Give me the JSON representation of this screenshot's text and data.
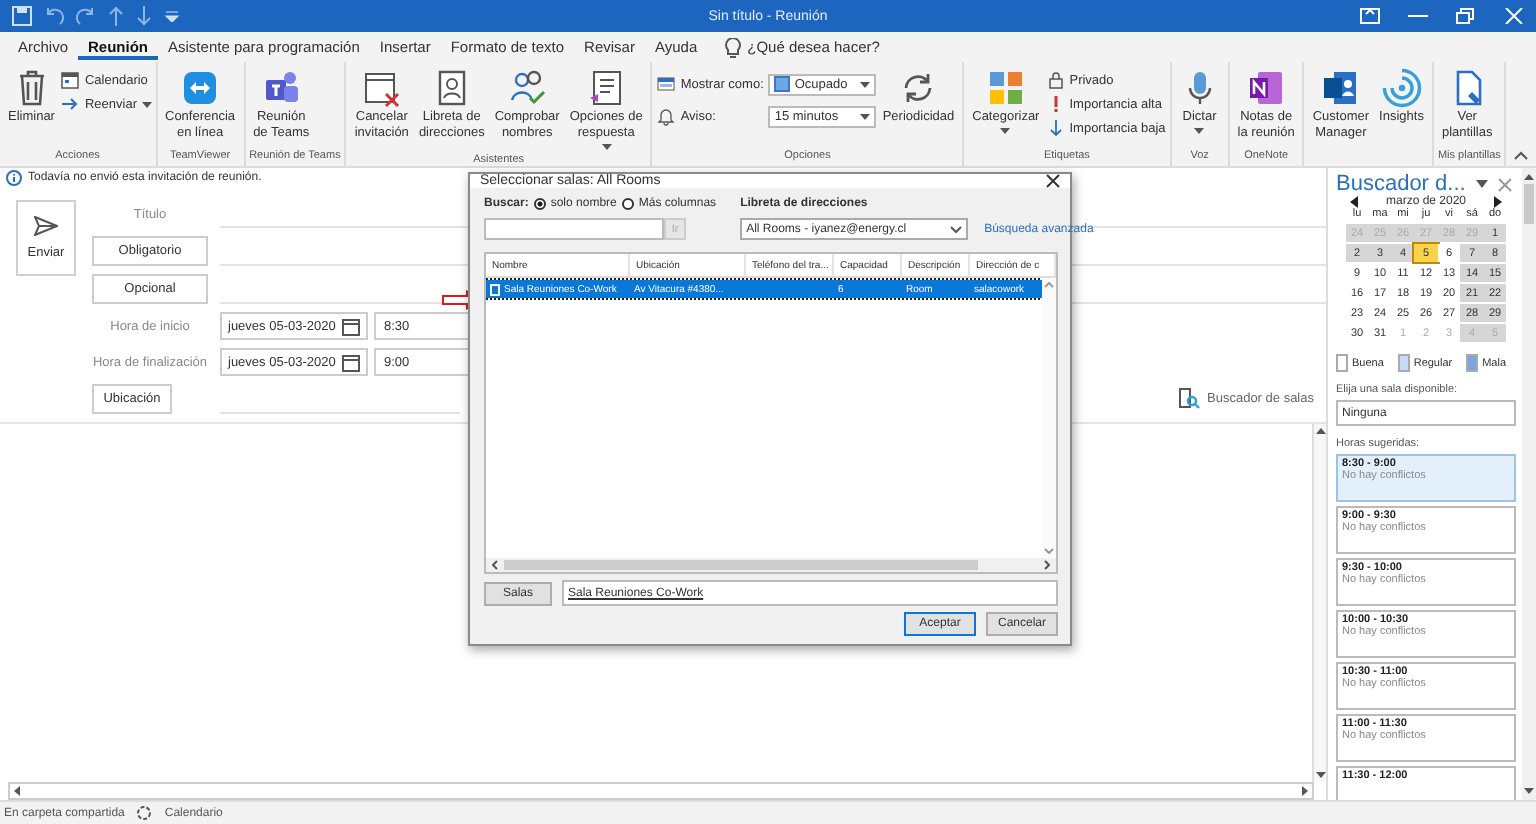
{
  "window": {
    "title": "Sin título  -  Reunión"
  },
  "menu_tabs": [
    {
      "label": "Archivo",
      "selected": false
    },
    {
      "label": "Reunión",
      "selected": true
    },
    {
      "label": "Asistente para programación",
      "selected": false
    },
    {
      "label": "Insertar",
      "selected": false
    },
    {
      "label": "Formato de texto",
      "selected": false
    },
    {
      "label": "Revisar",
      "selected": false
    },
    {
      "label": "Ayuda",
      "selected": false
    }
  ],
  "tell_me": {
    "placeholder": "¿Qué desea hacer?"
  },
  "ribbon": [
    {
      "label": "Acciones",
      "items": [
        {
          "kind": "large",
          "label": "Eliminar"
        },
        {
          "kind": "small",
          "label": "Calendario"
        },
        {
          "kind": "small",
          "label": "Reenviar",
          "menu": true
        }
      ]
    },
    {
      "label": "TeamViewer",
      "items": [
        {
          "kind": "large",
          "label": "Conferencia\nen línea"
        }
      ]
    },
    {
      "label": "Reunión de Teams",
      "items": [
        {
          "kind": "large",
          "label": "Reunión\nde Teams"
        }
      ]
    },
    {
      "label": "Asistentes",
      "items": [
        {
          "kind": "large",
          "label": "Cancelar\ninvitación"
        },
        {
          "kind": "large",
          "label": "Libreta de\ndirecciones"
        },
        {
          "kind": "large",
          "label": "Comprobar\nnombres"
        },
        {
          "kind": "large",
          "label": "Opciones de\nrespuesta",
          "menu": true
        }
      ]
    },
    {
      "label": "Opciones",
      "items": [
        {
          "kind": "field",
          "label": "Mostrar como:",
          "value": "Ocupado"
        },
        {
          "kind": "field",
          "label": "Aviso:",
          "value": "15 minutos"
        },
        {
          "kind": "large",
          "label": "Periodicidad"
        }
      ]
    },
    {
      "label": "Etiquetas",
      "items": [
        {
          "kind": "large",
          "label": "Categorizar",
          "menu": true
        },
        {
          "kind": "small",
          "label": "Privado"
        },
        {
          "kind": "small",
          "label": "Importancia alta"
        },
        {
          "kind": "small",
          "label": "Importancia baja"
        }
      ]
    },
    {
      "label": "Voz",
      "items": [
        {
          "kind": "large",
          "label": "Dictar",
          "menu": true
        }
      ]
    },
    {
      "label": "OneNote",
      "items": [
        {
          "kind": "large",
          "label": "Notas de\nla reunión"
        }
      ]
    },
    {
      "items": [
        {
          "kind": "large",
          "label": "Customer\nManager"
        },
        {
          "kind": "large",
          "label": "Insights"
        }
      ]
    },
    {
      "label": "Mis plantillas",
      "items": [
        {
          "kind": "large",
          "label": "Ver\nplantillas"
        }
      ]
    }
  ],
  "info_bar": "Todavía no envió esta invitación de reunión.",
  "form": {
    "send": "Enviar",
    "title_label": "Título",
    "required": "Obligatorio",
    "optional": "Opcional",
    "start_label": "Hora de inicio",
    "start_date": "jueves 05-03-2020",
    "start_time": "8:30",
    "end_label": "Hora de finalización",
    "end_date": "jueves 05-03-2020",
    "end_time": "9:00",
    "location": "Ubicación",
    "room_finder": "Buscador de salas"
  },
  "status_bar": {
    "folder": "En carpeta compartida",
    "calendar": "Calendario"
  },
  "dialog": {
    "title": "Seleccionar salas: All Rooms",
    "search_label": "Buscar:",
    "search_modes": [
      {
        "label": "solo nombre",
        "selected": true
      },
      {
        "label": "Más columnas",
        "selected": false
      }
    ],
    "address_book_label": "Libreta de direcciones",
    "go_button": {
      "label": "Ir",
      "disabled": true
    },
    "address_book": "All Rooms - iyanez@energy.cl",
    "advanced_link": "Búsqueda avanzada",
    "columns": [
      "Nombre",
      "Ubicación",
      "Teléfono del tra...",
      "Capacidad",
      "Descripción",
      "Dirección de c"
    ],
    "rows": [
      {
        "selected": true,
        "cells": [
          "Sala Reuniones Co-Work",
          "Av Vitacura #4380...",
          "",
          "6",
          "Room",
          "salacowork"
        ]
      }
    ],
    "rooms_button": "Salas",
    "rooms_value": "Sala Reuniones Co-Work",
    "ok": "Aceptar",
    "cancel": "Cancelar"
  },
  "room_finder": {
    "title": "Buscador d...",
    "month": "marzo de 2020",
    "weekdays": [
      "lu",
      "ma",
      "mi",
      "ju",
      "vi",
      "sá",
      "do"
    ],
    "weeks": [
      [
        {
          "day": "24",
          "muted": true,
          "shaded": true,
          "selected": false
        },
        {
          "day": "25",
          "muted": true,
          "shaded": true,
          "selected": false
        },
        {
          "day": "26",
          "muted": true,
          "shaded": true,
          "selected": false
        },
        {
          "day": "27",
          "muted": true,
          "shaded": true,
          "selected": false
        },
        {
          "day": "28",
          "muted": true,
          "shaded": true,
          "selected": false
        },
        {
          "day": "29",
          "muted": true,
          "shaded": true,
          "selected": false
        },
        {
          "day": "1",
          "muted": false,
          "shaded": true,
          "selected": false
        }
      ],
      [
        {
          "day": "2",
          "muted": false,
          "shaded": true,
          "selected": false
        },
        {
          "day": "3",
          "muted": false,
          "shaded": true,
          "selected": false
        },
        {
          "day": "4",
          "muted": false,
          "shaded": true,
          "selected": false
        },
        {
          "day": "5",
          "muted": false,
          "shaded": false,
          "selected": true
        },
        {
          "day": "6",
          "muted": false,
          "shaded": false,
          "selected": false
        },
        {
          "day": "7",
          "muted": false,
          "shaded": true,
          "selected": false
        },
        {
          "day": "8",
          "muted": false,
          "shaded": true,
          "selected": false
        }
      ],
      [
        {
          "day": "9",
          "muted": false,
          "shaded": false,
          "selected": false
        },
        {
          "day": "10",
          "muted": false,
          "shaded": false,
          "selected": false
        },
        {
          "day": "11",
          "muted": false,
          "shaded": false,
          "selected": false
        },
        {
          "day": "12",
          "muted": false,
          "shaded": false,
          "selected": false
        },
        {
          "day": "13",
          "muted": false,
          "shaded": false,
          "selected": false
        },
        {
          "day": "14",
          "muted": false,
          "shaded": true,
          "selected": false
        },
        {
          "day": "15",
          "muted": false,
          "shaded": true,
          "selected": false
        }
      ],
      [
        {
          "day": "16",
          "muted": false,
          "shaded": false,
          "selected": false
        },
        {
          "day": "17",
          "muted": false,
          "shaded": false,
          "selected": false
        },
        {
          "day": "18",
          "muted": false,
          "shaded": false,
          "selected": false
        },
        {
          "day": "19",
          "muted": false,
          "shaded": false,
          "selected": false
        },
        {
          "day": "20",
          "muted": false,
          "shaded": false,
          "selected": false
        },
        {
          "day": "21",
          "muted": false,
          "shaded": true,
          "selected": false
        },
        {
          "day": "22",
          "muted": false,
          "shaded": true,
          "selected": false
        }
      ],
      [
        {
          "day": "23",
          "muted": false,
          "shaded": false,
          "selected": false
        },
        {
          "day": "24",
          "muted": false,
          "shaded": false,
          "selected": false
        },
        {
          "day": "25",
          "muted": false,
          "shaded": false,
          "selected": false
        },
        {
          "day": "26",
          "muted": false,
          "shaded": false,
          "selected": false
        },
        {
          "day": "27",
          "muted": false,
          "shaded": false,
          "selected": false
        },
        {
          "day": "28",
          "muted": false,
          "shaded": true,
          "selected": false
        },
        {
          "day": "29",
          "muted": false,
          "shaded": true,
          "selected": false
        }
      ],
      [
        {
          "day": "30",
          "muted": false,
          "shaded": false,
          "selected": false
        },
        {
          "day": "31",
          "muted": false,
          "shaded": false,
          "selected": false
        },
        {
          "day": "1",
          "muted": true,
          "shaded": false,
          "selected": false
        },
        {
          "day": "2",
          "muted": true,
          "shaded": false,
          "selected": false
        },
        {
          "day": "3",
          "muted": true,
          "shaded": false,
          "selected": false
        },
        {
          "day": "4",
          "muted": true,
          "shaded": true,
          "selected": false
        },
        {
          "day": "5",
          "muted": true,
          "shaded": true,
          "selected": false
        }
      ]
    ],
    "legend": [
      {
        "label": "Buena",
        "color": "#ffffff"
      },
      {
        "label": "Regular",
        "color": "#c7dcf7"
      },
      {
        "label": "Mala",
        "color": "#7ba7e1"
      }
    ],
    "rooms_label": "Elija una sala disponible:",
    "rooms": [
      "Ninguna"
    ],
    "suggested_label": "Horas sugeridas:",
    "slots": [
      {
        "time": "8:30 - 9:00",
        "status": "No hay conflictos",
        "selected": true
      },
      {
        "time": "9:00 - 9:30",
        "status": "No hay conflictos",
        "selected": false
      },
      {
        "time": "9:30 - 10:00",
        "status": "No hay conflictos",
        "selected": false
      },
      {
        "time": "10:00 - 10:30",
        "status": "No hay conflictos",
        "selected": false
      },
      {
        "time": "10:30 - 11:00",
        "status": "No hay conflictos",
        "selected": false
      },
      {
        "time": "11:00 - 11:30",
        "status": "No hay conflictos",
        "selected": false
      },
      {
        "time": "11:30 - 12:00",
        "selected": false
      }
    ]
  }
}
